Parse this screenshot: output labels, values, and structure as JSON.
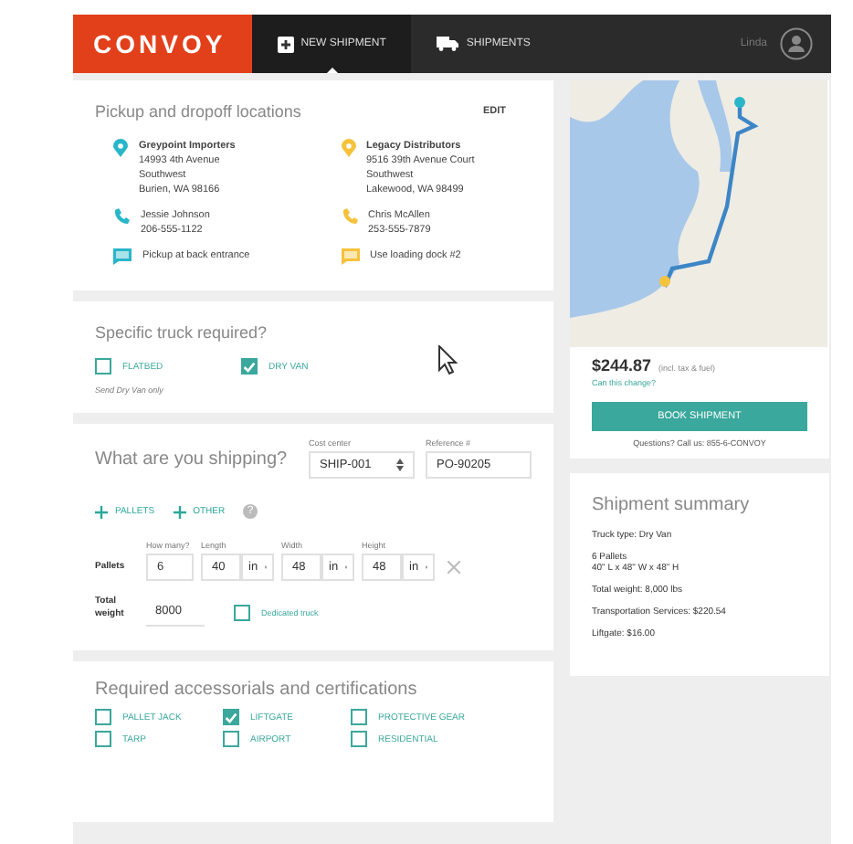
{
  "nav": {
    "logo": "CONVOY",
    "tabs": [
      {
        "label": "NEW SHIPMENT",
        "kind": "new",
        "selected": true
      },
      {
        "label": "SHIPMENTS",
        "kind": "truck",
        "selected": false
      }
    ],
    "user": "Linda"
  },
  "locations": {
    "title": "Pickup and dropoff locations",
    "edit": "EDIT",
    "stops": [
      {
        "kind": "pickup",
        "name": "Greypoint Importers",
        "address": [
          "14993 4th Avenue",
          "Southwest",
          "Burien, WA 98166"
        ],
        "contact": "Jessie Johnson",
        "phone": "206-555-1122",
        "note": "Pickup at back entrance"
      },
      {
        "kind": "dropoff",
        "name": "Legacy Distributors",
        "address": [
          "9516 39th Avenue Court",
          "Southwest",
          "Lakewood, WA 98499"
        ],
        "contact": "Chris McAllen",
        "phone": "253-555-7879",
        "note": "Use loading dock #2"
      }
    ]
  },
  "truck": {
    "title": "Specific truck required?",
    "options": [
      {
        "label": "FLATBED",
        "checked": false
      },
      {
        "label": "DRY VAN",
        "checked": true
      }
    ],
    "note": "Send Dry Van only"
  },
  "shipping": {
    "title": "What are you shipping?",
    "cost_center": {
      "label": "Cost center",
      "value": "SHIP-001"
    },
    "reference": {
      "label": "Reference #",
      "value": "PO-90205"
    },
    "add": [
      "PALLETS",
      "OTHER"
    ],
    "help": "?",
    "pallets": {
      "label": "Pallets",
      "count": {
        "label": "How many?",
        "value": "6"
      },
      "dims": [
        {
          "label": "Length",
          "value": "40",
          "unit": "in"
        },
        {
          "label": "Width",
          "value": "48",
          "unit": "in"
        },
        {
          "label": "Height",
          "value": "48",
          "unit": "in"
        }
      ]
    },
    "weight": {
      "label": "Total weight",
      "value": "8000"
    },
    "dedicated": {
      "label": "Dedicated truck",
      "checked": false
    }
  },
  "accessorials": {
    "title": "Required accessorials and certifications",
    "options": [
      {
        "label": "PALLET JACK",
        "checked": false
      },
      {
        "label": "LIFTGATE",
        "checked": true
      },
      {
        "label": "PROTECTIVE GEAR",
        "checked": false
      },
      {
        "label": "TARP",
        "checked": false
      },
      {
        "label": "AIRPORT",
        "checked": false
      },
      {
        "label": "RESIDENTIAL",
        "checked": false
      }
    ]
  },
  "quote": {
    "price": "$244.87",
    "price_note": "(incl. tax & fuel)",
    "link": "Can this change?",
    "button": "BOOK SHIPMENT",
    "contact": "Questions? Call us: 855-6-CONVOY"
  },
  "summary": {
    "title": "Shipment summary",
    "lines": [
      "Truck type: Dry Van",
      "6 Pallets\n40\" L x 48\" W x 48\" H",
      "Total weight: 8,000 lbs",
      "Transportation Services: $220.54",
      "Liftgate: $16.00"
    ]
  }
}
